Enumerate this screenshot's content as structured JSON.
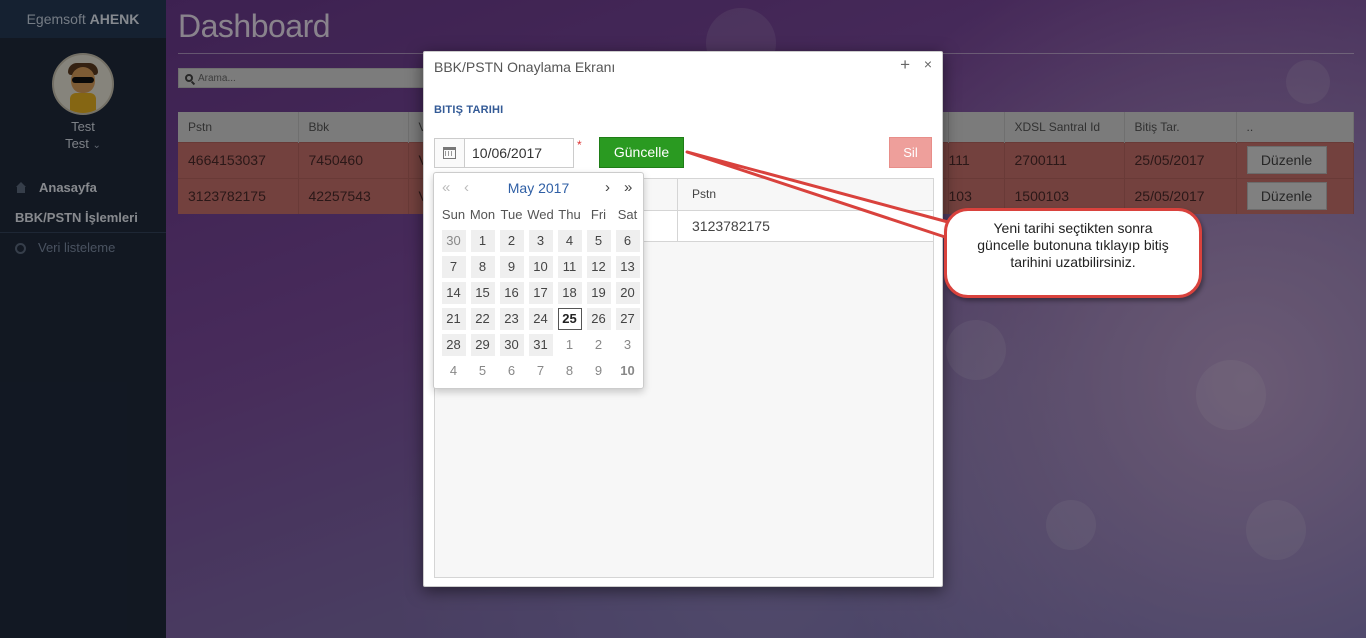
{
  "sidebar": {
    "brand_prefix": "Egemsoft",
    "brand_name": "AHENK",
    "user_name": "Test",
    "user_role": "Test",
    "nav": [
      {
        "label": "Anasayfa",
        "icon": "home-icon"
      },
      {
        "label": "BBK/PSTN İşlemleri"
      },
      {
        "label": "Veri listeleme",
        "icon": "circle-icon"
      }
    ]
  },
  "main": {
    "title": "Dashboard",
    "search_placeholder": "Arama...",
    "columns": [
      "Pstn",
      "Bbk",
      "Ve",
      "",
      "",
      "",
      "",
      "",
      "XDSL Santral Id",
      "Bitiş Tar.",
      ".."
    ],
    "rows": [
      {
        "pstn": "4664153037",
        "bbk": "7450460",
        "ve": "V",
        "mid": "111",
        "santral": "2700111",
        "bitis": "25/05/2017",
        "action": "Düzenle"
      },
      {
        "pstn": "3123782175",
        "bbk": "42257543",
        "ve": "V",
        "mid": "103",
        "santral": "1500103",
        "bitis": "25/05/2017",
        "action": "Düzenle"
      }
    ]
  },
  "modal": {
    "title": "BBK/PSTN Onaylama Ekranı",
    "plus": "+",
    "close": "×",
    "section_label": "BITIŞ TARIHI",
    "date_value": "10/06/2017",
    "required_mark": "*",
    "update_button": "Güncelle",
    "delete_button": "Sil",
    "table_header": "Pstn",
    "table_value": "3123782175"
  },
  "datepicker": {
    "month": "May 2017",
    "prev_year": "«",
    "prev_month": "‹",
    "next_month": "›",
    "next_year": "»",
    "weekdays": [
      "Sun",
      "Mon",
      "Tue",
      "Wed",
      "Thu",
      "Fri",
      "Sat"
    ],
    "weeks": [
      [
        "30",
        "1",
        "2",
        "3",
        "4",
        "5",
        "6"
      ],
      [
        "7",
        "8",
        "9",
        "10",
        "11",
        "12",
        "13"
      ],
      [
        "14",
        "15",
        "16",
        "17",
        "18",
        "19",
        "20"
      ],
      [
        "21",
        "22",
        "23",
        "24",
        "25",
        "26",
        "27"
      ],
      [
        "28",
        "29",
        "30",
        "31",
        "1",
        "2",
        "3"
      ],
      [
        "4",
        "5",
        "6",
        "7",
        "8",
        "9",
        "10"
      ]
    ],
    "today": "25",
    "selected": "10"
  },
  "callout": {
    "line1": "Yeni tarihi seçtikten sonra",
    "line2": "güncelle butonuna tıklayıp bitiş",
    "line3": "tarihini uzatbilirsiniz."
  },
  "colors": {
    "accent": "#2f5aa0",
    "update_green": "#2a9a21",
    "delete_red": "#ee9f9b",
    "callout_border": "#d9423d",
    "row_red": "#c7716b"
  }
}
